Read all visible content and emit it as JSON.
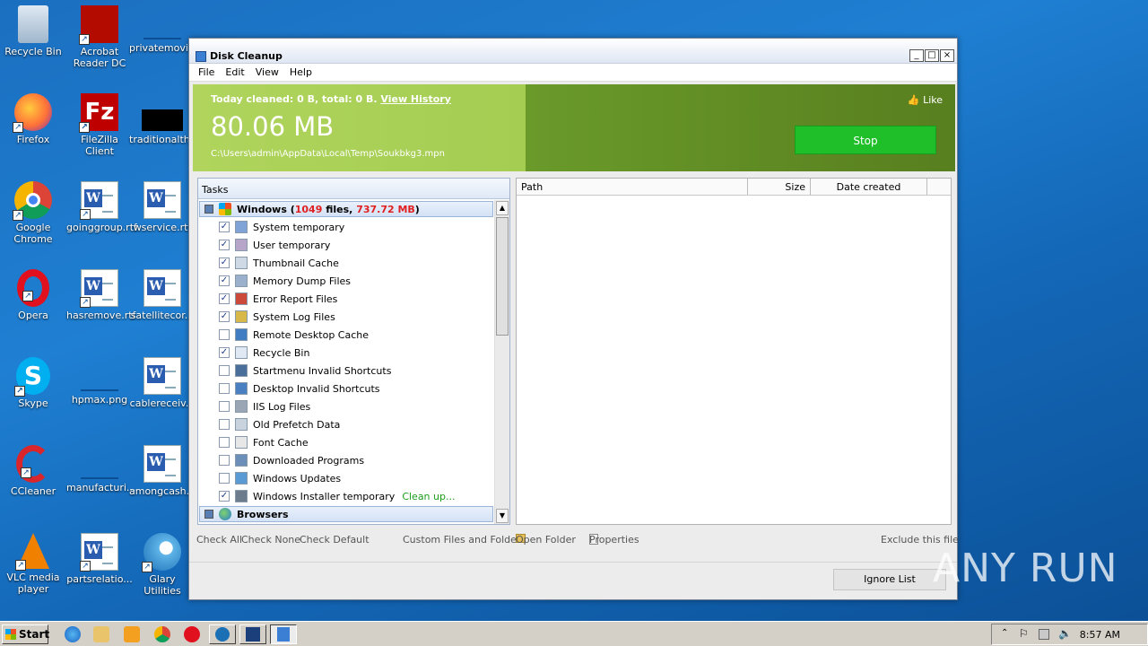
{
  "desktop": {
    "icons": [
      {
        "label": "Recycle Bin",
        "icon": "recycle-bin-icon"
      },
      {
        "label": "Acrobat Reader DC",
        "icon": "acrobat-icon"
      },
      {
        "label": "privatemovi...",
        "icon": "file-icon"
      },
      {
        "label": "Firefox",
        "icon": "firefox-icon"
      },
      {
        "label": "FileZilla Client",
        "icon": "filezilla-icon"
      },
      {
        "label": "traditionalth...",
        "icon": "file-icon"
      },
      {
        "label": "Google Chrome",
        "icon": "chrome-icon"
      },
      {
        "label": "goinggroup.rtf",
        "icon": "word-doc-icon"
      },
      {
        "label": "wservice.rtf",
        "icon": "word-doc-icon"
      },
      {
        "label": "Opera",
        "icon": "opera-icon"
      },
      {
        "label": "hasremove.rtf",
        "icon": "word-doc-icon"
      },
      {
        "label": "satellitecor...",
        "icon": "word-doc-icon"
      },
      {
        "label": "Skype",
        "icon": "skype-icon"
      },
      {
        "label": "hpmax.png",
        "icon": "image-icon"
      },
      {
        "label": "cablereceiv...",
        "icon": "word-doc-icon"
      },
      {
        "label": "CCleaner",
        "icon": "ccleaner-icon"
      },
      {
        "label": "manufacturi...",
        "icon": "file-icon"
      },
      {
        "label": "amongcash...",
        "icon": "word-doc-icon"
      },
      {
        "label": "VLC media player",
        "icon": "vlc-icon"
      },
      {
        "label": "partsrelatio...",
        "icon": "word-doc-icon"
      },
      {
        "label": "Glary Utilities",
        "icon": "glary-icon"
      }
    ]
  },
  "window": {
    "title": "Disk Cleanup",
    "buttons": [
      "_",
      "□",
      "×"
    ],
    "menu": [
      "File",
      "Edit",
      "View",
      "Help"
    ]
  },
  "banner": {
    "today_prefix": "Today cleaned: 0 B, total: 0 B.",
    "view_history": "View History",
    "size": "80.06 MB",
    "current_path": "C:\\Users\\admin\\AppData\\Local\\Temp\\Soukbkg3.mpn",
    "like": "Like",
    "stop": "Stop"
  },
  "tasks": {
    "header": "Tasks",
    "groups": [
      {
        "name": "Windows",
        "files_count": "1049",
        "files_word": "files,",
        "size": "737.72 MB",
        "items": [
          {
            "label": "System temporary",
            "checked": true,
            "icon": "windows-flag-icon"
          },
          {
            "label": "User temporary",
            "checked": true,
            "icon": "user-temp-icon"
          },
          {
            "label": "Thumbnail Cache",
            "checked": true,
            "icon": "thumbnail-icon"
          },
          {
            "label": "Memory Dump Files",
            "checked": true,
            "icon": "memory-dump-icon"
          },
          {
            "label": "Error Report Files",
            "checked": true,
            "icon": "error-report-icon"
          },
          {
            "label": "System Log Files",
            "checked": true,
            "icon": "system-log-icon"
          },
          {
            "label": "Remote Desktop Cache",
            "checked": false,
            "icon": "remote-desktop-icon"
          },
          {
            "label": "Recycle Bin",
            "checked": true,
            "icon": "recycle-bin-icon"
          },
          {
            "label": "Startmenu Invalid Shortcuts",
            "checked": false,
            "icon": "startmenu-icon"
          },
          {
            "label": "Desktop Invalid Shortcuts",
            "checked": false,
            "icon": "desktop-shortcut-icon"
          },
          {
            "label": "IIS Log Files",
            "checked": false,
            "icon": "iis-log-icon"
          },
          {
            "label": "Old Prefetch Data",
            "checked": false,
            "icon": "prefetch-icon"
          },
          {
            "label": "Font Cache",
            "checked": false,
            "icon": "font-cache-icon"
          },
          {
            "label": "Downloaded Programs",
            "checked": false,
            "icon": "downloaded-programs-icon"
          },
          {
            "label": "Windows Updates",
            "checked": false,
            "icon": "windows-update-icon"
          },
          {
            "label": "Windows Installer temporary",
            "checked": true,
            "icon": "installer-icon",
            "status": "Clean up..."
          }
        ]
      },
      {
        "name": "Browsers"
      }
    ]
  },
  "filelist": {
    "columns": [
      "Path",
      "Size",
      "Date created"
    ]
  },
  "bottom": {
    "check_all": "Check All",
    "check_none": "Check None",
    "check_default": "Check Default",
    "custom": "Custom Files and Folders",
    "open_folder": "Open Folder",
    "properties": "Properties",
    "exclude": "Exclude this file",
    "ignore_list": "Ignore List"
  },
  "taskbar": {
    "start": "Start",
    "clock": "8:57 AM"
  },
  "watermark": "ANY RUN"
}
